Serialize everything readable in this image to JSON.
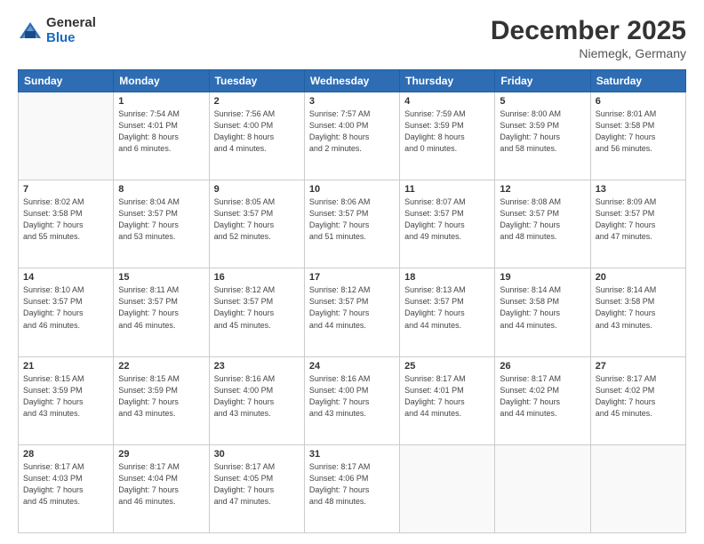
{
  "logo": {
    "general": "General",
    "blue": "Blue"
  },
  "header": {
    "month": "December 2025",
    "location": "Niemegk, Germany"
  },
  "weekdays": [
    "Sunday",
    "Monday",
    "Tuesday",
    "Wednesday",
    "Thursday",
    "Friday",
    "Saturday"
  ],
  "weeks": [
    [
      {
        "day": "",
        "info": ""
      },
      {
        "day": "1",
        "info": "Sunrise: 7:54 AM\nSunset: 4:01 PM\nDaylight: 8 hours\nand 6 minutes."
      },
      {
        "day": "2",
        "info": "Sunrise: 7:56 AM\nSunset: 4:00 PM\nDaylight: 8 hours\nand 4 minutes."
      },
      {
        "day": "3",
        "info": "Sunrise: 7:57 AM\nSunset: 4:00 PM\nDaylight: 8 hours\nand 2 minutes."
      },
      {
        "day": "4",
        "info": "Sunrise: 7:59 AM\nSunset: 3:59 PM\nDaylight: 8 hours\nand 0 minutes."
      },
      {
        "day": "5",
        "info": "Sunrise: 8:00 AM\nSunset: 3:59 PM\nDaylight: 7 hours\nand 58 minutes."
      },
      {
        "day": "6",
        "info": "Sunrise: 8:01 AM\nSunset: 3:58 PM\nDaylight: 7 hours\nand 56 minutes."
      }
    ],
    [
      {
        "day": "7",
        "info": "Sunrise: 8:02 AM\nSunset: 3:58 PM\nDaylight: 7 hours\nand 55 minutes."
      },
      {
        "day": "8",
        "info": "Sunrise: 8:04 AM\nSunset: 3:57 PM\nDaylight: 7 hours\nand 53 minutes."
      },
      {
        "day": "9",
        "info": "Sunrise: 8:05 AM\nSunset: 3:57 PM\nDaylight: 7 hours\nand 52 minutes."
      },
      {
        "day": "10",
        "info": "Sunrise: 8:06 AM\nSunset: 3:57 PM\nDaylight: 7 hours\nand 51 minutes."
      },
      {
        "day": "11",
        "info": "Sunrise: 8:07 AM\nSunset: 3:57 PM\nDaylight: 7 hours\nand 49 minutes."
      },
      {
        "day": "12",
        "info": "Sunrise: 8:08 AM\nSunset: 3:57 PM\nDaylight: 7 hours\nand 48 minutes."
      },
      {
        "day": "13",
        "info": "Sunrise: 8:09 AM\nSunset: 3:57 PM\nDaylight: 7 hours\nand 47 minutes."
      }
    ],
    [
      {
        "day": "14",
        "info": "Sunrise: 8:10 AM\nSunset: 3:57 PM\nDaylight: 7 hours\nand 46 minutes."
      },
      {
        "day": "15",
        "info": "Sunrise: 8:11 AM\nSunset: 3:57 PM\nDaylight: 7 hours\nand 46 minutes."
      },
      {
        "day": "16",
        "info": "Sunrise: 8:12 AM\nSunset: 3:57 PM\nDaylight: 7 hours\nand 45 minutes."
      },
      {
        "day": "17",
        "info": "Sunrise: 8:12 AM\nSunset: 3:57 PM\nDaylight: 7 hours\nand 44 minutes."
      },
      {
        "day": "18",
        "info": "Sunrise: 8:13 AM\nSunset: 3:57 PM\nDaylight: 7 hours\nand 44 minutes."
      },
      {
        "day": "19",
        "info": "Sunrise: 8:14 AM\nSunset: 3:58 PM\nDaylight: 7 hours\nand 44 minutes."
      },
      {
        "day": "20",
        "info": "Sunrise: 8:14 AM\nSunset: 3:58 PM\nDaylight: 7 hours\nand 43 minutes."
      }
    ],
    [
      {
        "day": "21",
        "info": "Sunrise: 8:15 AM\nSunset: 3:59 PM\nDaylight: 7 hours\nand 43 minutes."
      },
      {
        "day": "22",
        "info": "Sunrise: 8:15 AM\nSunset: 3:59 PM\nDaylight: 7 hours\nand 43 minutes."
      },
      {
        "day": "23",
        "info": "Sunrise: 8:16 AM\nSunset: 4:00 PM\nDaylight: 7 hours\nand 43 minutes."
      },
      {
        "day": "24",
        "info": "Sunrise: 8:16 AM\nSunset: 4:00 PM\nDaylight: 7 hours\nand 43 minutes."
      },
      {
        "day": "25",
        "info": "Sunrise: 8:17 AM\nSunset: 4:01 PM\nDaylight: 7 hours\nand 44 minutes."
      },
      {
        "day": "26",
        "info": "Sunrise: 8:17 AM\nSunset: 4:02 PM\nDaylight: 7 hours\nand 44 minutes."
      },
      {
        "day": "27",
        "info": "Sunrise: 8:17 AM\nSunset: 4:02 PM\nDaylight: 7 hours\nand 45 minutes."
      }
    ],
    [
      {
        "day": "28",
        "info": "Sunrise: 8:17 AM\nSunset: 4:03 PM\nDaylight: 7 hours\nand 45 minutes."
      },
      {
        "day": "29",
        "info": "Sunrise: 8:17 AM\nSunset: 4:04 PM\nDaylight: 7 hours\nand 46 minutes."
      },
      {
        "day": "30",
        "info": "Sunrise: 8:17 AM\nSunset: 4:05 PM\nDaylight: 7 hours\nand 47 minutes."
      },
      {
        "day": "31",
        "info": "Sunrise: 8:17 AM\nSunset: 4:06 PM\nDaylight: 7 hours\nand 48 minutes."
      },
      {
        "day": "",
        "info": ""
      },
      {
        "day": "",
        "info": ""
      },
      {
        "day": "",
        "info": ""
      }
    ]
  ]
}
